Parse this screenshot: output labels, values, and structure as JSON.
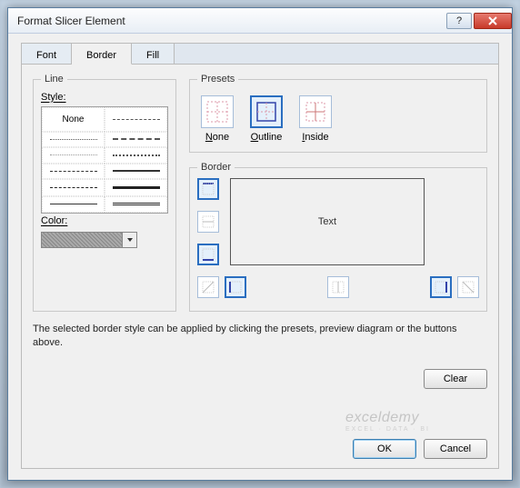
{
  "title": "Format Slicer Element",
  "tabs": {
    "font": "Font",
    "border": "Border",
    "fill": "Fill"
  },
  "line": {
    "legend": "Line",
    "style_label": "Style:",
    "none": "None",
    "color_label": "Color:"
  },
  "presets": {
    "legend": "Presets",
    "none": "None",
    "outline": "Outline",
    "inside": "Inside"
  },
  "border": {
    "legend": "Border",
    "preview_text": "Text"
  },
  "hint": "The selected border style can be applied by clicking the presets, preview diagram or the buttons above.",
  "buttons": {
    "clear": "Clear",
    "ok": "OK",
    "cancel": "Cancel"
  },
  "watermark": {
    "brand": "exceldemy",
    "sub": "EXCEL · DATA · BI"
  }
}
